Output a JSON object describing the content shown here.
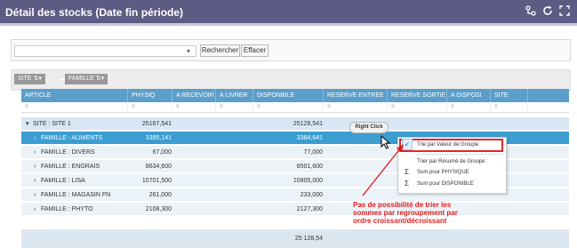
{
  "window": {
    "title": "Détail des stocks (Date fin période)",
    "icons": [
      "hierarchy-icon",
      "refresh-icon",
      "expand-icon"
    ]
  },
  "search": {
    "select_value": "",
    "search_button": "Rechercher",
    "clear_button": "Effacer"
  },
  "group_panel": {
    "chips": [
      "SITE",
      "FAMILLE"
    ]
  },
  "grid": {
    "columns": [
      "ARTICLE",
      "PHYSIQ",
      "A RECEVOIR",
      "A LIVRER",
      "DISPONIBLE",
      "RESERVE ENTREE",
      "RESERVE SORTIE",
      "A DISPOSI",
      "SITE"
    ],
    "filter_symbol": "≡",
    "rows": [
      {
        "label": "SITE : SITE 1",
        "physique": "25167,541",
        "disponible": "25128,541",
        "type": "site"
      },
      {
        "label": "FAMILLE : ALIMENTS",
        "physique": "3395,141",
        "disponible": "3384,641",
        "type": "family",
        "selected": true
      },
      {
        "label": "FAMILLE : DIVERS",
        "physique": "67,000",
        "disponible": "77,000",
        "type": "family"
      },
      {
        "label": "FAMILLE : ENGRAIS",
        "physique": "8634,600",
        "disponible": "8501,600",
        "type": "family"
      },
      {
        "label": "FAMILLE : LISA",
        "physique": "10701,500",
        "disponible": "10805,000",
        "type": "family"
      },
      {
        "label": "FAMILLE : MAGASIN FN",
        "physique": "261,000",
        "disponible": "233,000",
        "type": "family"
      },
      {
        "label": "FAMILLE : PHYTO",
        "physique": "2108,300",
        "disponible": "2127,300",
        "type": "family"
      }
    ],
    "footer_disponible": "25 128,54"
  },
  "context_menu": {
    "bubble_label": "Right Click",
    "items": [
      {
        "label": "Trie par Valeur de Groupe",
        "icon": "check-icon"
      },
      {
        "label": "Trier par Résumé de Groupe :",
        "icon": ""
      },
      {
        "label": "Sum pour PHYSIQUE",
        "icon": "sigma-icon"
      },
      {
        "label": "Sum pour DISPONIBLE",
        "icon": "sigma-icon"
      }
    ]
  },
  "annotation": {
    "lines": [
      "Pas de possibilité de trier les",
      "sommes par regroupement par",
      "ordre croissant/décroissant"
    ],
    "color": "#e02020"
  },
  "colors": {
    "title_bar": "#5b5b83",
    "grid_header": "#5b9ec9",
    "selected_row": "#3b9dd0",
    "row_bg": "#ebf2f8"
  }
}
